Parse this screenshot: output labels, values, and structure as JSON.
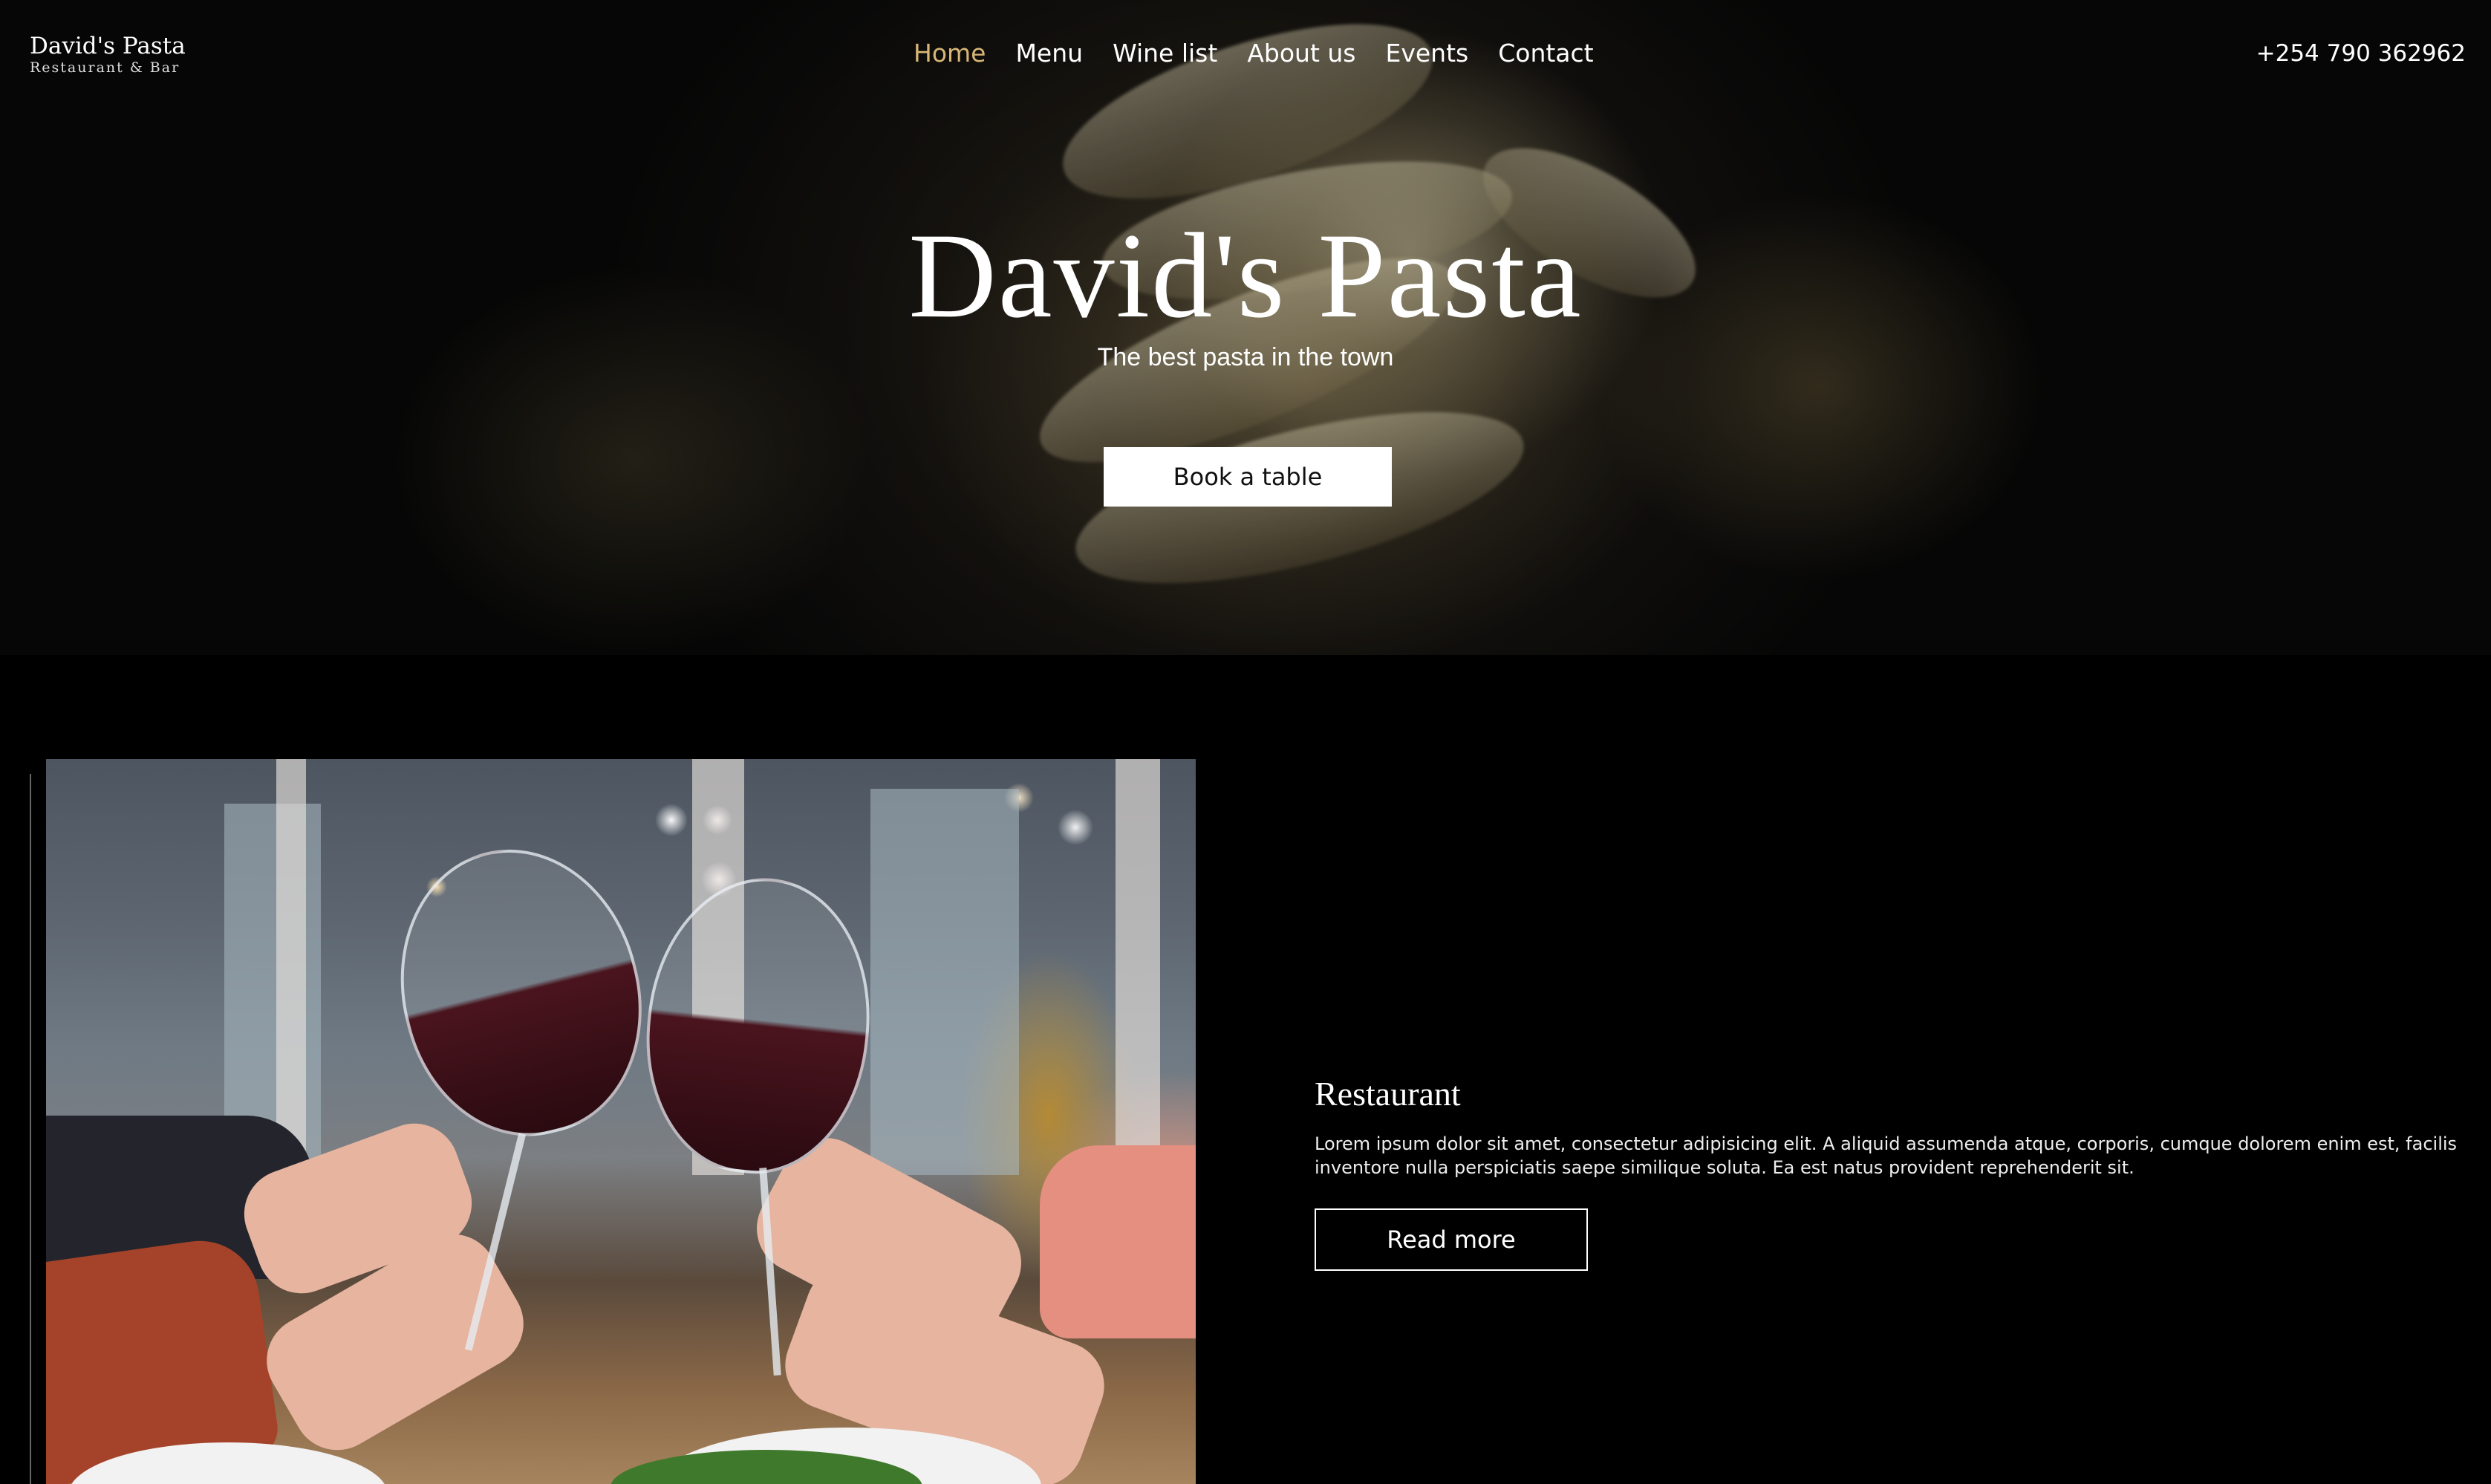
{
  "brand": {
    "name": "David's Pasta",
    "tagline": "Restaurant & Bar"
  },
  "nav": {
    "items": [
      {
        "label": "Home",
        "active": true
      },
      {
        "label": "Menu",
        "active": false
      },
      {
        "label": "Wine list",
        "active": false
      },
      {
        "label": "About us",
        "active": false
      },
      {
        "label": "Events",
        "active": false
      },
      {
        "label": "Contact",
        "active": false
      }
    ],
    "phone": "+254 790 362962"
  },
  "hero": {
    "title": "David's Pasta",
    "subtitle": "The best pasta in the town",
    "cta_label": "Book a table"
  },
  "restaurant": {
    "title": "Restaurant",
    "body": "Lorem ipsum dolor sit amet, consectetur adipisicing elit. A aliquid assumenda atque, corporis, cumque dolorem enim est, facilis inventore nulla perspiciatis saepe similique soluta. Ea est natus provident reprehenderit sit.",
    "cta_label": "Read more"
  },
  "colors": {
    "background": "#000000",
    "nav_active": "#d8b776",
    "text": "#ffffff"
  }
}
